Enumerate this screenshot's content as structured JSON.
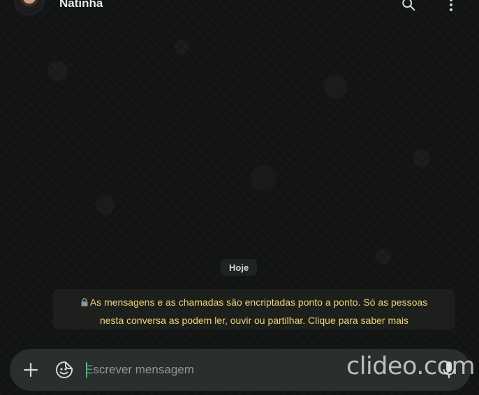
{
  "header": {
    "contact_name": "Natinha",
    "avatar_icon": "avatar-photo",
    "search_icon": "search-icon",
    "menu_icon": "more-vertical-icon"
  },
  "chat": {
    "date_label": "Hoje",
    "e2e_notice": {
      "line1": "As mensagens e as chamadas são encriptadas ponto a ponto. Só as pessoas",
      "line2": "nesta conversa as podem ler, ouvir ou partilhar. Clique para saber mais",
      "icon": "lock-icon",
      "text_color": "#f2d479"
    }
  },
  "composer": {
    "placeholder": "Escrever mensagem",
    "value": "",
    "attach_icon": "plus-icon",
    "sticker_icon": "sticker-icon",
    "mic_icon": "microphone-icon",
    "accent_color": "#25d366"
  },
  "watermark": "clideo.com"
}
